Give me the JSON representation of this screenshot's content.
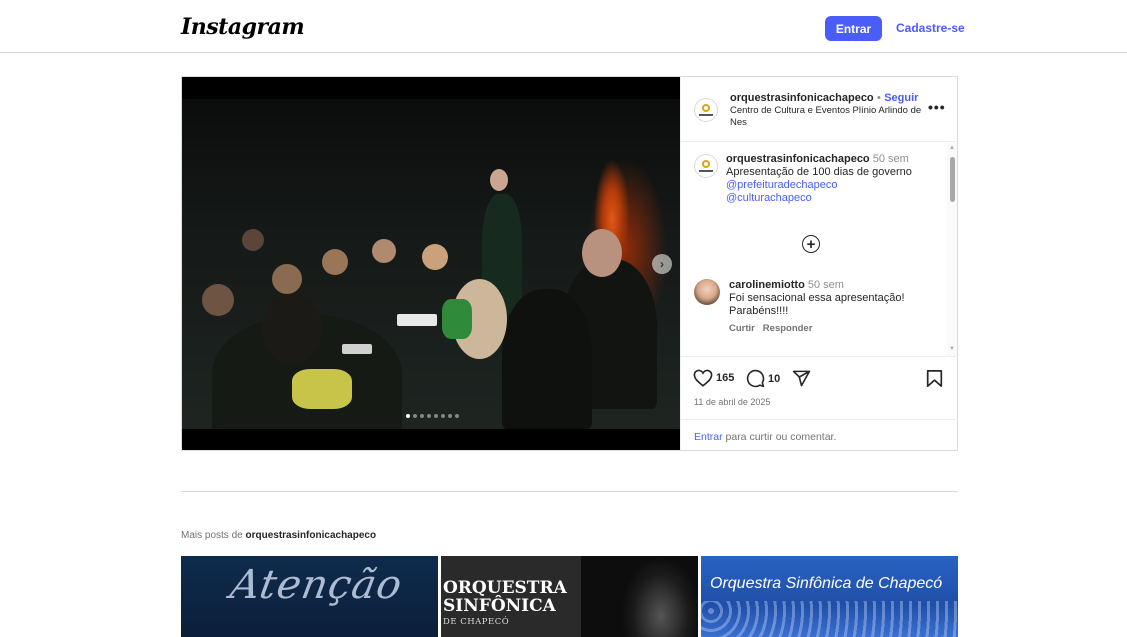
{
  "header": {
    "logo": "Instagram",
    "login_label": "Entrar",
    "signup_label": "Cadastre-se"
  },
  "post": {
    "author": "orquestrasinfonicachapeco",
    "separator": "•",
    "follow_label": "Seguir",
    "location": "Centro de Cultura e Eventos Plínio Arlindo de Nes",
    "caption": {
      "author": "orquestrasinfonicachapeco",
      "time": "50 sem",
      "text": "Apresentação de 100 dias de governo",
      "mentions": [
        "@prefeituradechapeco",
        "@culturachapeco"
      ]
    },
    "comment": {
      "author": "carolinemiotto",
      "time": "50 sem",
      "text": "Foi sensacional essa apresentação! Parabéns!!!!",
      "like_label": "Curtir",
      "reply_label": "Responder"
    },
    "likes": "165",
    "comments_count": "10",
    "date": "11 de abril de 2025",
    "login_link": "Entrar",
    "login_suffix": " para curtir ou comentar.",
    "carousel_current": 1,
    "carousel_total": 8
  },
  "more_posts": {
    "prefix": "Mais posts de ",
    "author": "orquestrasinfonicachapeco",
    "thumbs": [
      {
        "text": "Atenção"
      },
      {
        "line1": "ORQUESTRA",
        "line2": "SINFÔNICA",
        "line3": "DE CHAPECÓ"
      },
      {
        "text": "Orquestra Sinfônica de Chapecó"
      }
    ]
  },
  "colors": {
    "accent": "#4a5df9",
    "border": "#dbdbdb",
    "muted": "#737373"
  },
  "icons": [
    "heart-icon",
    "comment-icon",
    "share-icon",
    "bookmark-icon",
    "more-icon",
    "plus-circle-icon",
    "chevron-right-icon"
  ]
}
